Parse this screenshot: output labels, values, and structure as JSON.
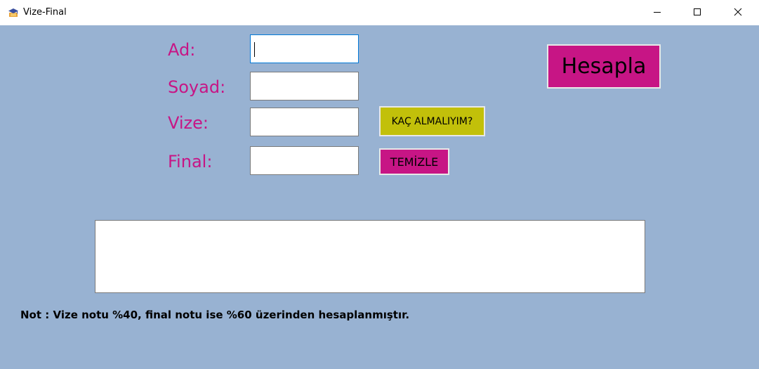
{
  "window": {
    "title": "Vize-Final",
    "icon": "graduation-cap-icon"
  },
  "title_buttons": {
    "minimize": "minimize-icon",
    "maximize": "maximize-icon",
    "close": "close-icon"
  },
  "form": {
    "ad_label": "Ad:",
    "ad_value": "",
    "soyad_label": "Soyad:",
    "soyad_value": "",
    "vize_label": "Vize:",
    "vize_value": "",
    "final_label": "Final:",
    "final_value": ""
  },
  "buttons": {
    "hesapla": "Hesapla",
    "kac_almaliyim": "KAÇ ALMALIYIM?",
    "temizle": "TEMİZLE"
  },
  "result": {
    "text": ""
  },
  "note": "Not : Vize notu %40, final notu ise %60 üzerinden hesaplanmıştır.",
  "colors": {
    "background": "#98b2d2",
    "label_color": "#c71585",
    "hesapla_button": "#c71585",
    "kac_button": "#c2c00a",
    "temizle_button": "#c71585"
  }
}
